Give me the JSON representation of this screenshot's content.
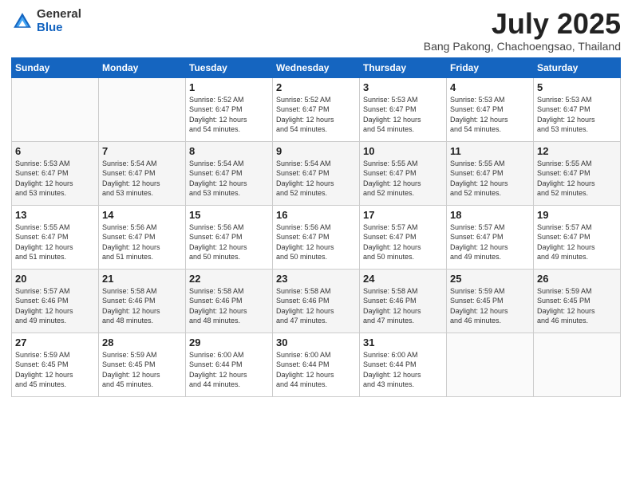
{
  "header": {
    "logo_general": "General",
    "logo_blue": "Blue",
    "month_title": "July 2025",
    "location": "Bang Pakong, Chachoengsao, Thailand"
  },
  "days_of_week": [
    "Sunday",
    "Monday",
    "Tuesday",
    "Wednesday",
    "Thursday",
    "Friday",
    "Saturday"
  ],
  "weeks": [
    [
      {
        "day": "",
        "info": ""
      },
      {
        "day": "",
        "info": ""
      },
      {
        "day": "1",
        "sunrise": "5:52 AM",
        "sunset": "6:47 PM",
        "daylight": "12 hours and 54 minutes."
      },
      {
        "day": "2",
        "sunrise": "5:52 AM",
        "sunset": "6:47 PM",
        "daylight": "12 hours and 54 minutes."
      },
      {
        "day": "3",
        "sunrise": "5:53 AM",
        "sunset": "6:47 PM",
        "daylight": "12 hours and 54 minutes."
      },
      {
        "day": "4",
        "sunrise": "5:53 AM",
        "sunset": "6:47 PM",
        "daylight": "12 hours and 54 minutes."
      },
      {
        "day": "5",
        "sunrise": "5:53 AM",
        "sunset": "6:47 PM",
        "daylight": "12 hours and 53 minutes."
      }
    ],
    [
      {
        "day": "6",
        "sunrise": "5:53 AM",
        "sunset": "6:47 PM",
        "daylight": "12 hours and 53 minutes."
      },
      {
        "day": "7",
        "sunrise": "5:54 AM",
        "sunset": "6:47 PM",
        "daylight": "12 hours and 53 minutes."
      },
      {
        "day": "8",
        "sunrise": "5:54 AM",
        "sunset": "6:47 PM",
        "daylight": "12 hours and 53 minutes."
      },
      {
        "day": "9",
        "sunrise": "5:54 AM",
        "sunset": "6:47 PM",
        "daylight": "12 hours and 52 minutes."
      },
      {
        "day": "10",
        "sunrise": "5:55 AM",
        "sunset": "6:47 PM",
        "daylight": "12 hours and 52 minutes."
      },
      {
        "day": "11",
        "sunrise": "5:55 AM",
        "sunset": "6:47 PM",
        "daylight": "12 hours and 52 minutes."
      },
      {
        "day": "12",
        "sunrise": "5:55 AM",
        "sunset": "6:47 PM",
        "daylight": "12 hours and 52 minutes."
      }
    ],
    [
      {
        "day": "13",
        "sunrise": "5:55 AM",
        "sunset": "6:47 PM",
        "daylight": "12 hours and 51 minutes."
      },
      {
        "day": "14",
        "sunrise": "5:56 AM",
        "sunset": "6:47 PM",
        "daylight": "12 hours and 51 minutes."
      },
      {
        "day": "15",
        "sunrise": "5:56 AM",
        "sunset": "6:47 PM",
        "daylight": "12 hours and 50 minutes."
      },
      {
        "day": "16",
        "sunrise": "5:56 AM",
        "sunset": "6:47 PM",
        "daylight": "12 hours and 50 minutes."
      },
      {
        "day": "17",
        "sunrise": "5:57 AM",
        "sunset": "6:47 PM",
        "daylight": "12 hours and 50 minutes."
      },
      {
        "day": "18",
        "sunrise": "5:57 AM",
        "sunset": "6:47 PM",
        "daylight": "12 hours and 49 minutes."
      },
      {
        "day": "19",
        "sunrise": "5:57 AM",
        "sunset": "6:47 PM",
        "daylight": "12 hours and 49 minutes."
      }
    ],
    [
      {
        "day": "20",
        "sunrise": "5:57 AM",
        "sunset": "6:46 PM",
        "daylight": "12 hours and 49 minutes."
      },
      {
        "day": "21",
        "sunrise": "5:58 AM",
        "sunset": "6:46 PM",
        "daylight": "12 hours and 48 minutes."
      },
      {
        "day": "22",
        "sunrise": "5:58 AM",
        "sunset": "6:46 PM",
        "daylight": "12 hours and 48 minutes."
      },
      {
        "day": "23",
        "sunrise": "5:58 AM",
        "sunset": "6:46 PM",
        "daylight": "12 hours and 47 minutes."
      },
      {
        "day": "24",
        "sunrise": "5:58 AM",
        "sunset": "6:46 PM",
        "daylight": "12 hours and 47 minutes."
      },
      {
        "day": "25",
        "sunrise": "5:59 AM",
        "sunset": "6:45 PM",
        "daylight": "12 hours and 46 minutes."
      },
      {
        "day": "26",
        "sunrise": "5:59 AM",
        "sunset": "6:45 PM",
        "daylight": "12 hours and 46 minutes."
      }
    ],
    [
      {
        "day": "27",
        "sunrise": "5:59 AM",
        "sunset": "6:45 PM",
        "daylight": "12 hours and 45 minutes."
      },
      {
        "day": "28",
        "sunrise": "5:59 AM",
        "sunset": "6:45 PM",
        "daylight": "12 hours and 45 minutes."
      },
      {
        "day": "29",
        "sunrise": "6:00 AM",
        "sunset": "6:44 PM",
        "daylight": "12 hours and 44 minutes."
      },
      {
        "day": "30",
        "sunrise": "6:00 AM",
        "sunset": "6:44 PM",
        "daylight": "12 hours and 44 minutes."
      },
      {
        "day": "31",
        "sunrise": "6:00 AM",
        "sunset": "6:44 PM",
        "daylight": "12 hours and 43 minutes."
      },
      {
        "day": "",
        "info": ""
      },
      {
        "day": "",
        "info": ""
      }
    ]
  ],
  "labels": {
    "sunrise": "Sunrise:",
    "sunset": "Sunset:",
    "daylight": "Daylight:"
  }
}
